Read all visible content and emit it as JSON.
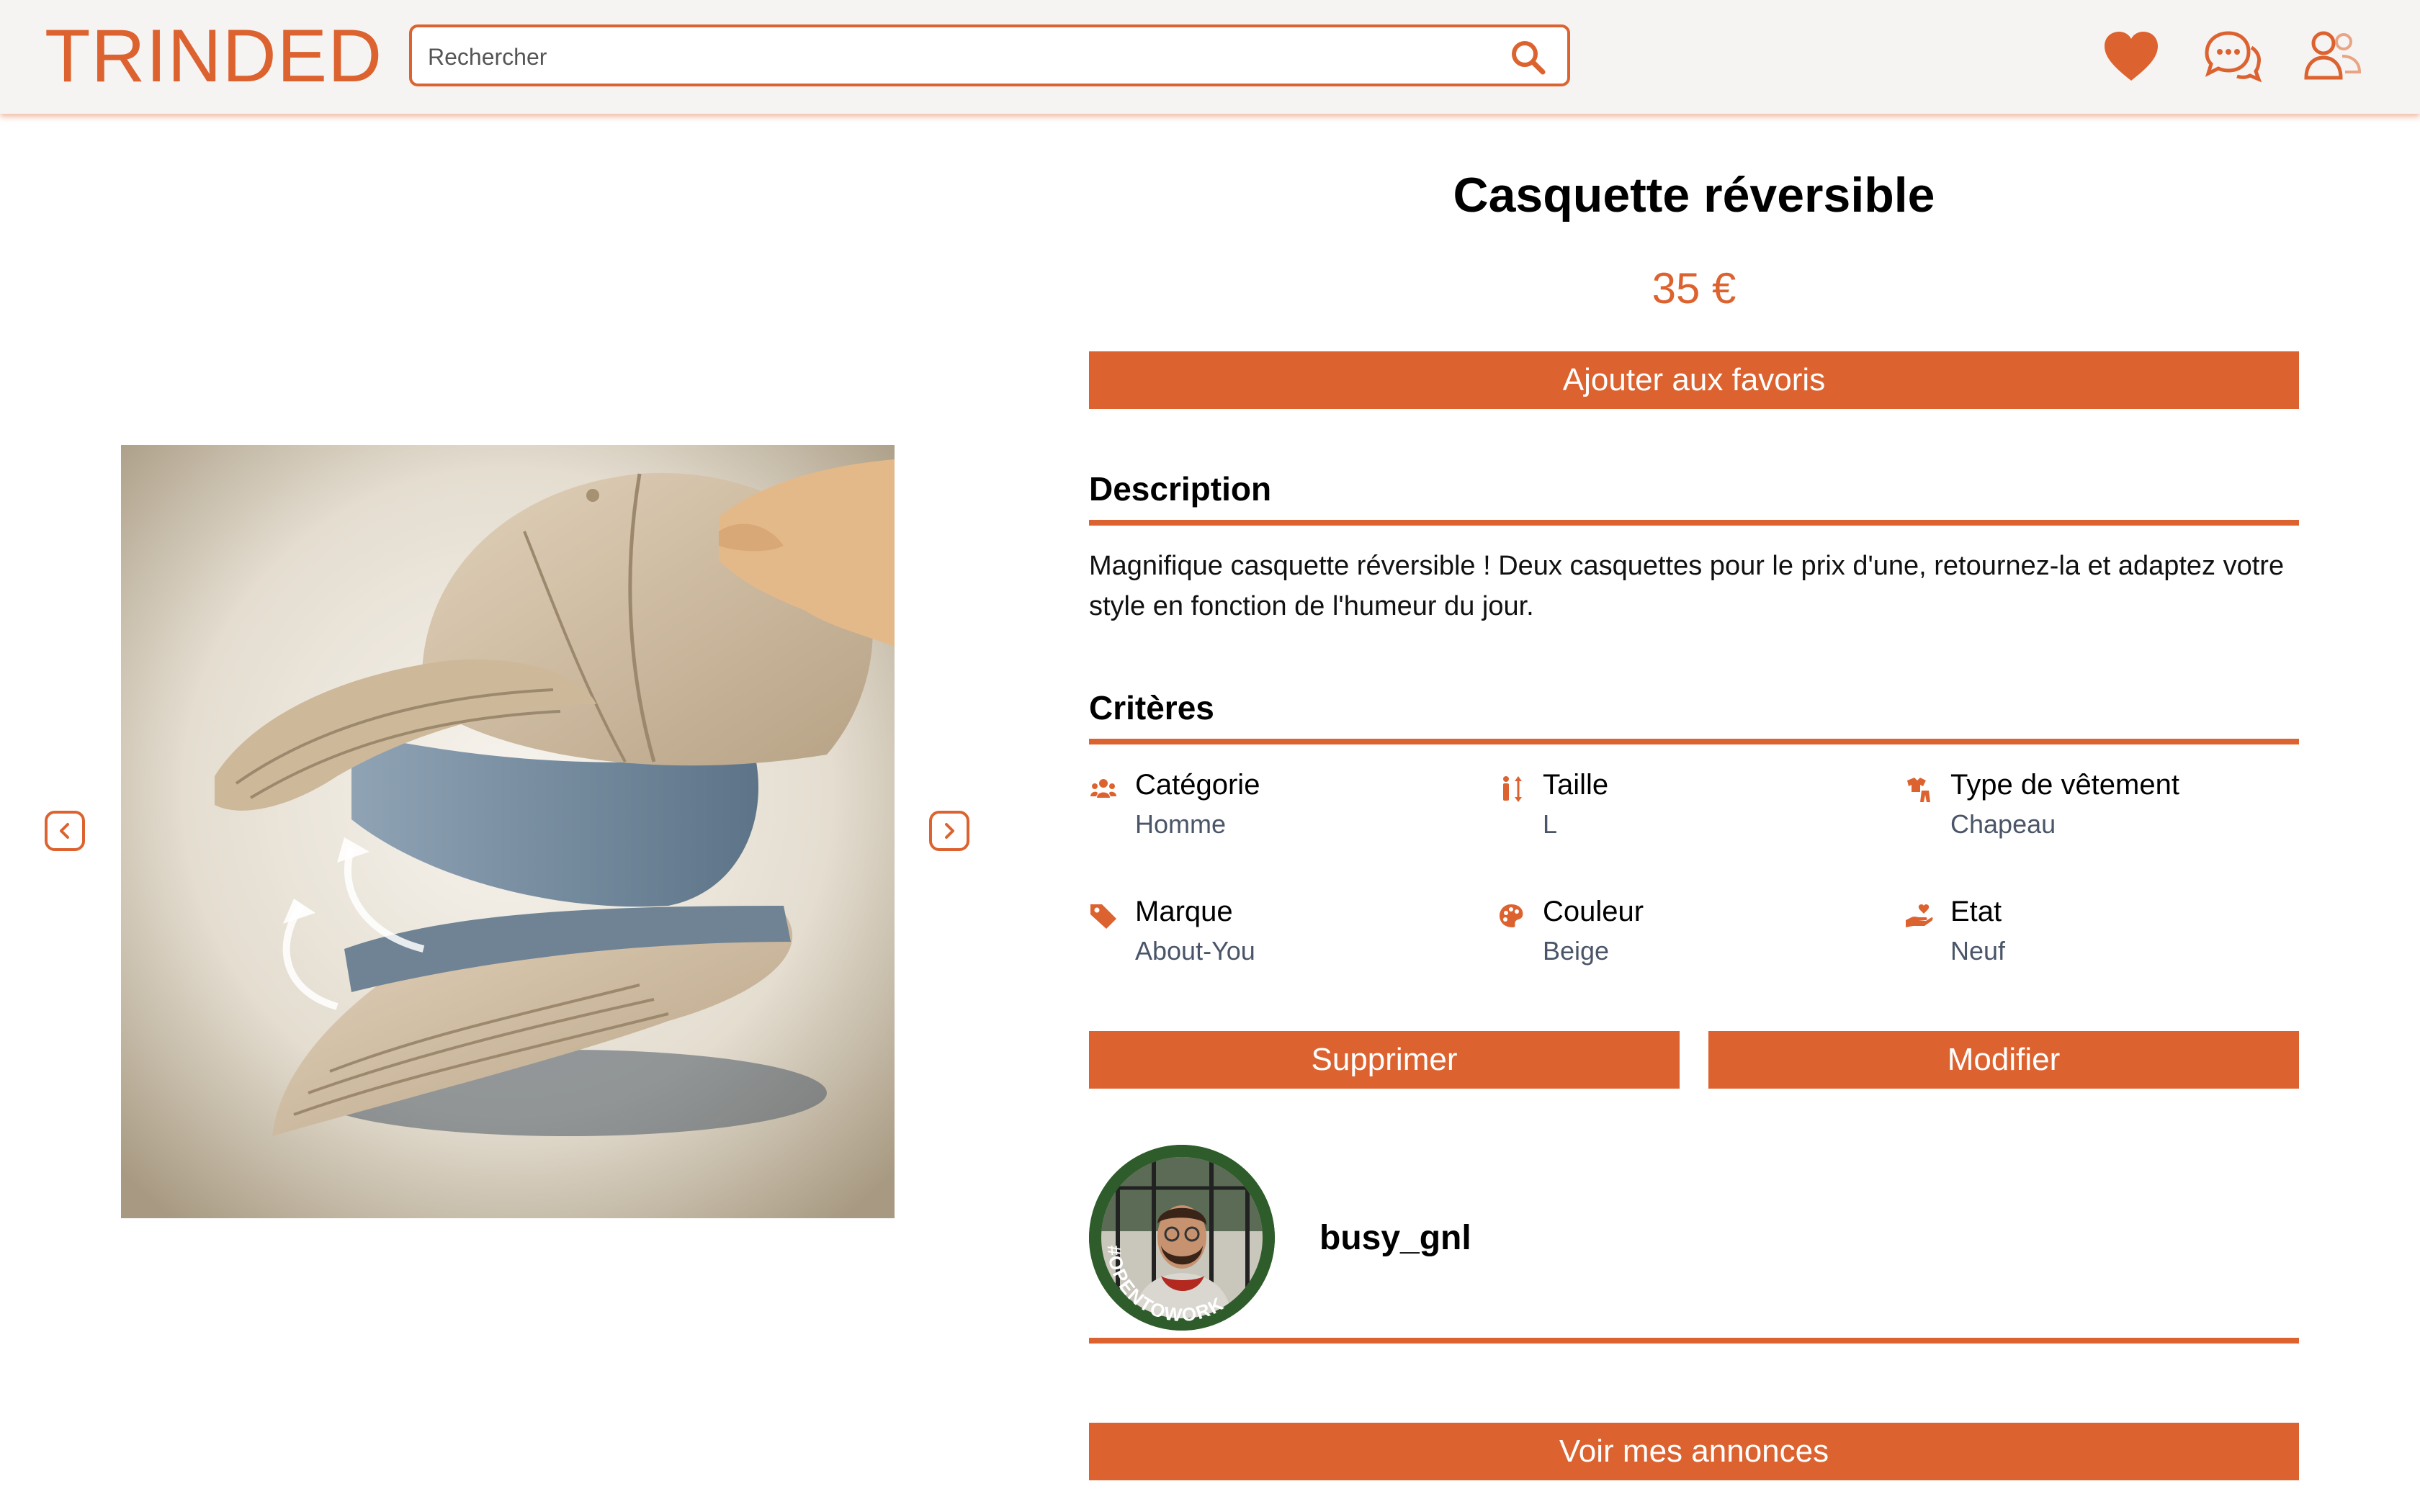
{
  "header": {
    "logo": "TRINDED",
    "search_placeholder": "Rechercher",
    "icons": [
      "search-icon",
      "heart-icon",
      "chat-icon",
      "users-icon"
    ]
  },
  "product": {
    "title": "Casquette réversible",
    "price": "35 €",
    "favorite_button": "Ajouter aux favoris",
    "description_heading": "Description",
    "description": "Magnifique casquette réversible ! Deux casquettes pour le prix d'une, retournez-la et adaptez votre style en fonction de l'humeur du jour.",
    "criteria_heading": "Critères",
    "criteria": [
      {
        "label": "Catégorie",
        "value": "Homme",
        "icon": "people-icon"
      },
      {
        "label": "Taille",
        "value": "L",
        "icon": "height-icon"
      },
      {
        "label": "Type de vêtement",
        "value": "Chapeau",
        "icon": "clothing-icon"
      },
      {
        "label": "Marque",
        "value": "About-You",
        "icon": "tag-icon"
      },
      {
        "label": "Couleur",
        "value": "Beige",
        "icon": "palette-icon"
      },
      {
        "label": "Etat",
        "value": "Neuf",
        "icon": "hand-heart-icon"
      }
    ],
    "delete_button": "Supprimer",
    "edit_button": "Modifier"
  },
  "seller": {
    "username": "busy_gnl",
    "badge_text": "#OPENTOWORK",
    "listings_button": "Voir mes annonces"
  },
  "colors": {
    "accent": "#DC6330",
    "header_bg": "#f5f4f2",
    "muted": "#4a5568"
  }
}
